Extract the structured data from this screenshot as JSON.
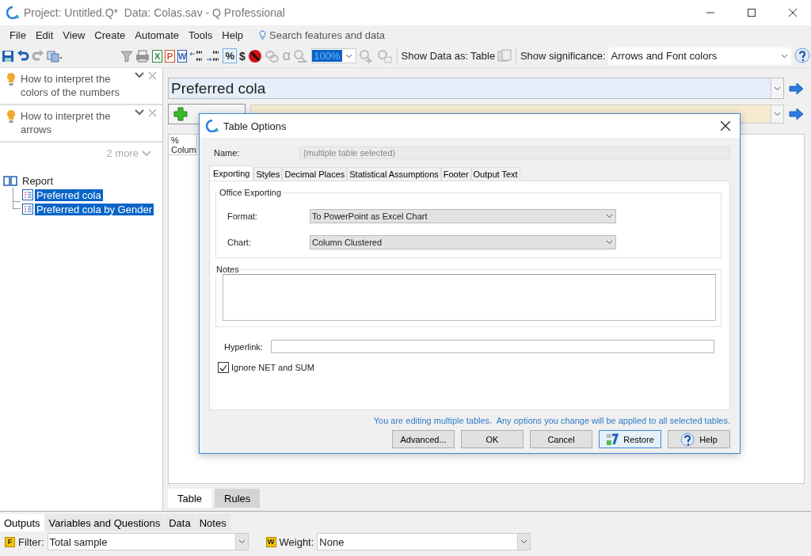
{
  "window": {
    "title": "Project: Untitled.Q*  Data: Colas.sav - Q Professional"
  },
  "menu": [
    {
      "label": "File"
    },
    {
      "label": "Edit"
    },
    {
      "label": "View"
    },
    {
      "label": "Create"
    },
    {
      "label": "Automate"
    },
    {
      "label": "Tools"
    },
    {
      "label": "Help"
    }
  ],
  "search": {
    "placeholder": "Search features and data"
  },
  "toolbar": {
    "letter_buttons": [
      {
        "label": "X",
        "color": "#2e8b3e"
      },
      {
        "label": "P",
        "color": "#d2502a"
      },
      {
        "label": "W",
        "color": "#2b5fb3"
      }
    ],
    "percent": {
      "label": "%",
      "on": true
    },
    "dollar": "$",
    "alpha": "α",
    "zoom": "100%",
    "show_data_label": "Show Data as:",
    "show_data_value": "Table",
    "significance_label": "Show significance:",
    "significance_value": "Arrows and Font colors"
  },
  "sidebar": {
    "tips": [
      {
        "text": "How to interpret the colors of the numbers"
      },
      {
        "text": "How to interpret the arrows"
      }
    ],
    "more": "2 more",
    "tree": {
      "label": "Report",
      "children": [
        {
          "label": "Preferred cola",
          "selected": true
        },
        {
          "label": "Preferred cola by Gender",
          "selected": true
        }
      ]
    }
  },
  "main": {
    "title": "Preferred cola",
    "table_header": [
      "%",
      "Colum"
    ],
    "tabs": [
      {
        "label": "Table",
        "selected": true
      },
      {
        "label": "Rules",
        "selected": false
      }
    ]
  },
  "dialog": {
    "title": "Table Options",
    "name_label": "Name:",
    "name_value": "(multiple table selected)",
    "tabs": [
      {
        "label": "Exporting",
        "selected": true
      },
      {
        "label": "Styles",
        "selected": false
      },
      {
        "label": "Decimal Places",
        "selected": false
      },
      {
        "label": "Statistical Assumptions",
        "selected": false
      },
      {
        "label": "Footer",
        "selected": false
      },
      {
        "label": "Output Text",
        "selected": false
      }
    ],
    "group": "Office Exporting",
    "fields": [
      {
        "label": "Format:",
        "value": "To PowerPoint as Excel Chart"
      },
      {
        "label": "Chart:",
        "value": "Column Clustered"
      }
    ],
    "notes_label": "Notes",
    "hyperlink_label": "Hyperlink:",
    "checkbox": {
      "label": "Ignore NET and SUM",
      "checked": true
    },
    "message": "You are editing multiple tables.  Any options you change will be applied to all selected tables.",
    "buttons": [
      {
        "label": "Advanced...",
        "kind": "plain"
      },
      {
        "label": "OK",
        "kind": "plain"
      },
      {
        "label": "Cancel",
        "kind": "plain"
      },
      {
        "label": "Restore",
        "kind": "restore"
      },
      {
        "label": "Help",
        "kind": "help"
      }
    ]
  },
  "bottom": {
    "tabs": [
      {
        "label": "Outputs",
        "selected": true
      },
      {
        "label": "Variables and Questions",
        "selected": false
      },
      {
        "label": "Data",
        "selected": false
      },
      {
        "label": "Notes",
        "selected": false
      }
    ],
    "filter": {
      "badge": "F",
      "label": "Filter:",
      "value": "Total sample"
    },
    "weight": {
      "badge": "W",
      "label": "Weight:",
      "value": "None"
    }
  }
}
